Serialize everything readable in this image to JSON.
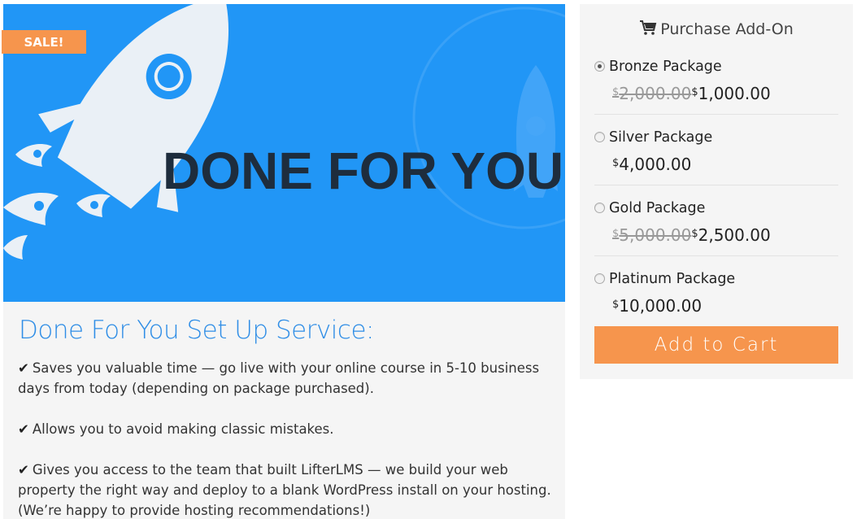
{
  "hero": {
    "sale_badge": "SALE!",
    "title": "DONE FOR YOU"
  },
  "description": {
    "heading": "Done For You Set Up Service:",
    "bullets": [
      "Saves you valuable time — go live with your online course in 5-10 business days from today (depending on package purchased).",
      "Allows you to avoid making classic mistakes.",
      "Gives you access to the team that built LifterLMS — we build your web property the right way and deploy to a blank WordPress install on your hosting. (We’re happy to provide hosting recommendations!)"
    ],
    "check_icon": "✔"
  },
  "sidebar": {
    "title": "Purchase Add-On",
    "cart_icon": "cart-icon",
    "currency_symbol": "$",
    "packages": [
      {
        "name": "Bronze Package",
        "old_price": "2,000.00",
        "price": "1,000.00",
        "selected": true
      },
      {
        "name": "Silver Package",
        "old_price": "",
        "price": "4,000.00",
        "selected": false
      },
      {
        "name": "Gold Package",
        "old_price": "5,000.00",
        "price": "2,500.00",
        "selected": false
      },
      {
        "name": "Platinum Package",
        "old_price": "",
        "price": "10,000.00",
        "selected": false
      }
    ],
    "add_to_cart": "Add to Cart"
  },
  "colors": {
    "hero_bg": "#2196f6",
    "accent_orange": "#f6954d",
    "heading_blue": "#2e8de6",
    "panel_bg": "#f5f5f5"
  }
}
